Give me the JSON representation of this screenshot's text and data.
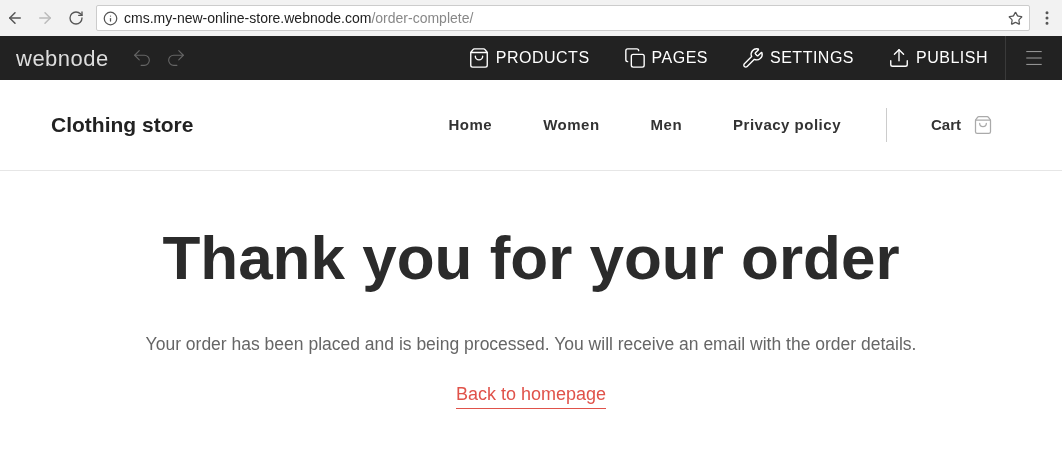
{
  "browser": {
    "url_host": "cms.my-new-online-store.webnode.com",
    "url_path": "/order-complete/"
  },
  "editor_bar": {
    "logo": "webnode",
    "actions": [
      {
        "kind": "products",
        "label": "PRODUCTS"
      },
      {
        "kind": "pages",
        "label": "PAGES"
      },
      {
        "kind": "settings",
        "label": "SETTINGS"
      },
      {
        "kind": "publish",
        "label": "PUBLISH"
      }
    ]
  },
  "site_header": {
    "title": "Clothing store",
    "nav": [
      "Home",
      "Women",
      "Men",
      "Privacy policy"
    ],
    "cart": "Cart"
  },
  "content": {
    "heading": "Thank you for your order",
    "message": "Your order has been placed and is being processed. You will receive an email with the order details.",
    "link": "Back to homepage"
  }
}
